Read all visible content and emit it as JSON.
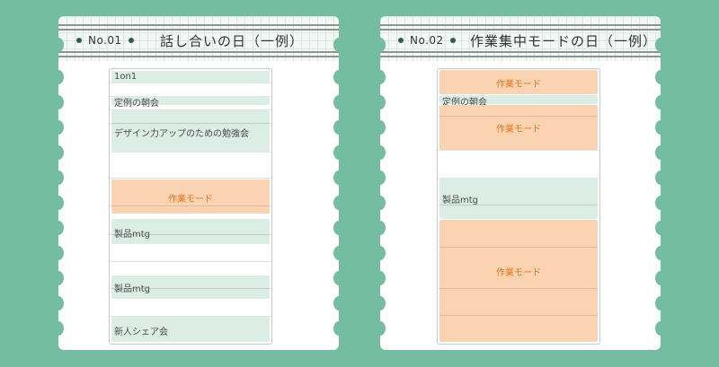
{
  "cards": [
    {
      "number": "No.01",
      "title": "話し合いの日（一例）",
      "events": [
        {
          "label": "1on1",
          "type": "meeting"
        },
        {
          "label": "定例の朝会",
          "type": "meeting"
        },
        {
          "label": "デザイン力アップのための勉強会",
          "type": "meeting"
        },
        {
          "label": "作業モード",
          "type": "work"
        },
        {
          "label": "製品mtg",
          "type": "meeting"
        },
        {
          "label": "製品mtg",
          "type": "meeting"
        },
        {
          "label": "新人シェア会",
          "type": "meeting"
        }
      ]
    },
    {
      "number": "No.02",
      "title": "作業集中モードの日（一例）",
      "events": [
        {
          "label": "作業モード",
          "type": "work"
        },
        {
          "label": "定例の朝会",
          "type": "meeting"
        },
        {
          "label": "作業モード",
          "type": "work"
        },
        {
          "label": "製品mtg",
          "type": "meeting"
        },
        {
          "label": "作業モード",
          "type": "work"
        }
      ]
    }
  ],
  "colors": {
    "background": "#74bda3",
    "meeting": "#dcede6",
    "work": "#fad3b3",
    "work_text": "#e3761f"
  }
}
